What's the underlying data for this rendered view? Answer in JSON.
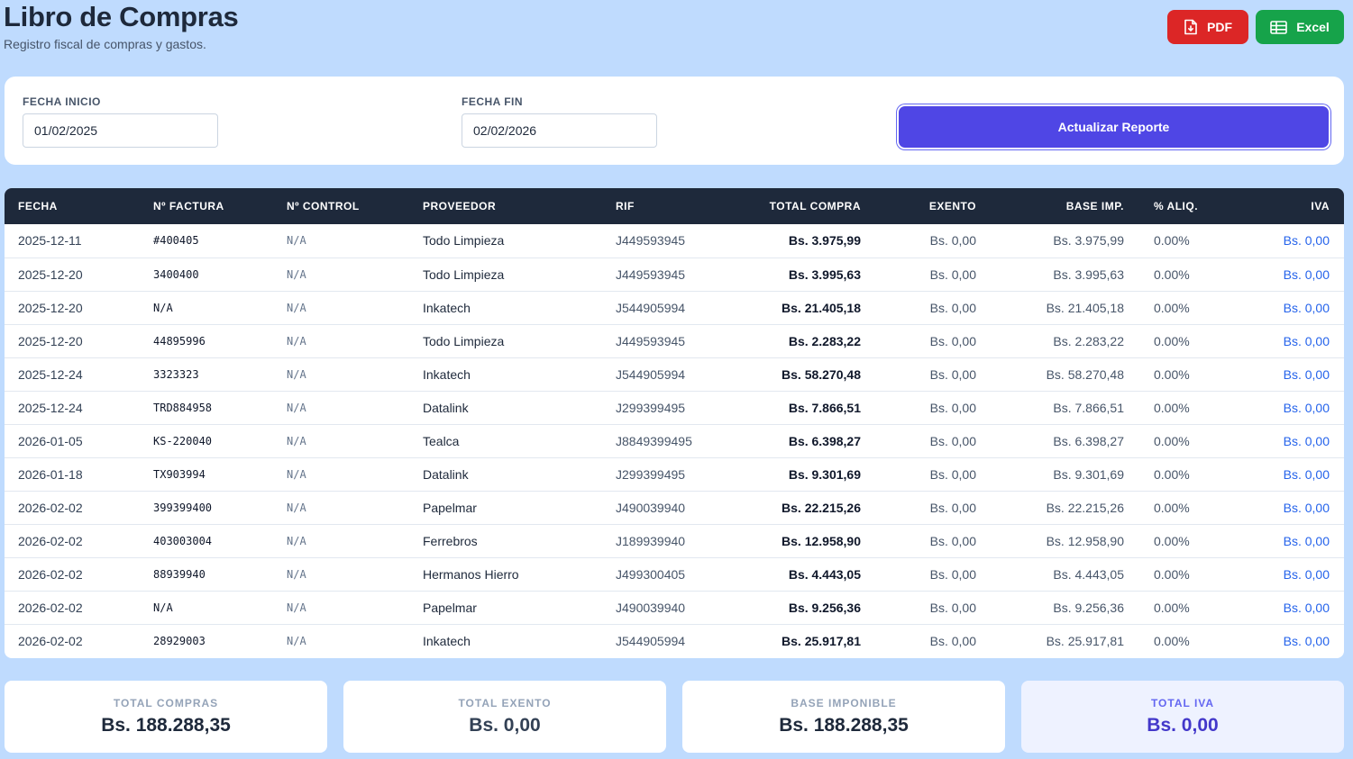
{
  "header": {
    "title": "Libro de Compras",
    "subtitle": "Registro fiscal de compras y gastos."
  },
  "actions": {
    "pdf_label": "PDF",
    "excel_label": "Excel"
  },
  "filters": {
    "start_label": "FECHA INICIO",
    "start_value": "01/02/2025",
    "end_label": "FECHA FIN",
    "end_value": "02/02/2026",
    "update_label": "Actualizar Reporte"
  },
  "table": {
    "columns": [
      "FECHA",
      "Nº FACTURA",
      "Nº CONTROL",
      "PROVEEDOR",
      "RIF",
      "TOTAL COMPRA",
      "EXENTO",
      "BASE IMP.",
      "% ALIQ.",
      "IVA"
    ],
    "rows": [
      {
        "fecha": "2025-12-11",
        "factura": "#400405",
        "control": "N/A",
        "proveedor": "Todo Limpieza",
        "rif": "J449593945",
        "total": "Bs. 3.975,99",
        "exento": "Bs. 0,00",
        "base": "Bs. 3.975,99",
        "aliq": "0.00%",
        "iva": "Bs. 0,00"
      },
      {
        "fecha": "2025-12-20",
        "factura": "3400400",
        "control": "N/A",
        "proveedor": "Todo Limpieza",
        "rif": "J449593945",
        "total": "Bs. 3.995,63",
        "exento": "Bs. 0,00",
        "base": "Bs. 3.995,63",
        "aliq": "0.00%",
        "iva": "Bs. 0,00"
      },
      {
        "fecha": "2025-12-20",
        "factura": "N/A",
        "control": "N/A",
        "proveedor": "Inkatech",
        "rif": "J544905994",
        "total": "Bs. 21.405,18",
        "exento": "Bs. 0,00",
        "base": "Bs. 21.405,18",
        "aliq": "0.00%",
        "iva": "Bs. 0,00"
      },
      {
        "fecha": "2025-12-20",
        "factura": "44895996",
        "control": "N/A",
        "proveedor": "Todo Limpieza",
        "rif": "J449593945",
        "total": "Bs. 2.283,22",
        "exento": "Bs. 0,00",
        "base": "Bs. 2.283,22",
        "aliq": "0.00%",
        "iva": "Bs. 0,00"
      },
      {
        "fecha": "2025-12-24",
        "factura": "3323323",
        "control": "N/A",
        "proveedor": "Inkatech",
        "rif": "J544905994",
        "total": "Bs. 58.270,48",
        "exento": "Bs. 0,00",
        "base": "Bs. 58.270,48",
        "aliq": "0.00%",
        "iva": "Bs. 0,00"
      },
      {
        "fecha": "2025-12-24",
        "factura": "TRD884958",
        "control": "N/A",
        "proveedor": "Datalink",
        "rif": "J299399495",
        "total": "Bs. 7.866,51",
        "exento": "Bs. 0,00",
        "base": "Bs. 7.866,51",
        "aliq": "0.00%",
        "iva": "Bs. 0,00"
      },
      {
        "fecha": "2026-01-05",
        "factura": "KS-220040",
        "control": "N/A",
        "proveedor": "Tealca",
        "rif": "J8849399495",
        "total": "Bs. 6.398,27",
        "exento": "Bs. 0,00",
        "base": "Bs. 6.398,27",
        "aliq": "0.00%",
        "iva": "Bs. 0,00"
      },
      {
        "fecha": "2026-01-18",
        "factura": "TX903994",
        "control": "N/A",
        "proveedor": "Datalink",
        "rif": "J299399495",
        "total": "Bs. 9.301,69",
        "exento": "Bs. 0,00",
        "base": "Bs. 9.301,69",
        "aliq": "0.00%",
        "iva": "Bs. 0,00"
      },
      {
        "fecha": "2026-02-02",
        "factura": "399399400",
        "control": "N/A",
        "proveedor": "Papelmar",
        "rif": "J490039940",
        "total": "Bs. 22.215,26",
        "exento": "Bs. 0,00",
        "base": "Bs. 22.215,26",
        "aliq": "0.00%",
        "iva": "Bs. 0,00"
      },
      {
        "fecha": "2026-02-02",
        "factura": "403003004",
        "control": "N/A",
        "proveedor": "Ferrebros",
        "rif": "J189939940",
        "total": "Bs. 12.958,90",
        "exento": "Bs. 0,00",
        "base": "Bs. 12.958,90",
        "aliq": "0.00%",
        "iva": "Bs. 0,00"
      },
      {
        "fecha": "2026-02-02",
        "factura": "88939940",
        "control": "N/A",
        "proveedor": "Hermanos Hierro",
        "rif": "J499300405",
        "total": "Bs. 4.443,05",
        "exento": "Bs. 0,00",
        "base": "Bs. 4.443,05",
        "aliq": "0.00%",
        "iva": "Bs. 0,00"
      },
      {
        "fecha": "2026-02-02",
        "factura": "N/A",
        "control": "N/A",
        "proveedor": "Papelmar",
        "rif": "J490039940",
        "total": "Bs. 9.256,36",
        "exento": "Bs. 0,00",
        "base": "Bs. 9.256,36",
        "aliq": "0.00%",
        "iva": "Bs. 0,00"
      },
      {
        "fecha": "2026-02-02",
        "factura": "28929003",
        "control": "N/A",
        "proveedor": "Inkatech",
        "rif": "J544905994",
        "total": "Bs. 25.917,81",
        "exento": "Bs. 0,00",
        "base": "Bs. 25.917,81",
        "aliq": "0.00%",
        "iva": "Bs. 0,00"
      }
    ]
  },
  "summary": [
    {
      "label": "TOTAL COMPRAS",
      "value": "Bs. 188.288,35"
    },
    {
      "label": "TOTAL EXENTO",
      "value": "Bs. 0,00"
    },
    {
      "label": "BASE IMPONIBLE",
      "value": "Bs. 188.288,35"
    },
    {
      "label": "TOTAL IVA",
      "value": "Bs. 0,00"
    }
  ],
  "icons": {
    "pdf": "file-pdf-icon",
    "excel": "spreadsheet-icon"
  },
  "colors": {
    "background": "#bfdbfe",
    "pdf": "#dc2626",
    "excel": "#16a34a",
    "primary": "#4f46e5",
    "table_header": "#1e293b",
    "iva": "#2563eb"
  }
}
